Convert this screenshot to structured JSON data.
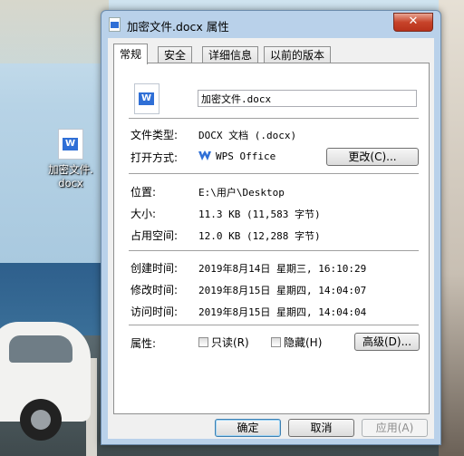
{
  "desktop": {
    "icon_label_line1": "加密文件.",
    "icon_label_line2": "docx",
    "icon_glyph": "W"
  },
  "window": {
    "title": "加密文件.docx 属性",
    "close_glyph": "✕"
  },
  "tabs": [
    {
      "label": "常规",
      "active": true
    },
    {
      "label": "安全"
    },
    {
      "label": "详细信息"
    },
    {
      "label": "以前的版本"
    }
  ],
  "general": {
    "file_glyph": "W",
    "file_name": "加密文件.docx",
    "type_label": "文件类型:",
    "type_value": "DOCX 文档 (.docx)",
    "opens_with_label": "打开方式:",
    "opens_with_value": "WPS Office",
    "change_button": "更改(C)...",
    "location_label": "位置:",
    "location_value": "E:\\用户\\Desktop",
    "size_label": "大小:",
    "size_value": "11.3 KB (11,583 字节)",
    "size_on_disk_label": "占用空间:",
    "size_on_disk_value": "12.0 KB (12,288 字节)",
    "created_label": "创建时间:",
    "created_value": "2019年8月14日 星期三, 16:10:29",
    "modified_label": "修改时间:",
    "modified_value": "2019年8月15日 星期四, 14:04:07",
    "accessed_label": "访问时间:",
    "accessed_value": "2019年8月15日 星期四, 14:04:04",
    "attributes_label": "属性:",
    "readonly_label": "只读(R)",
    "readonly_checked": false,
    "hidden_label": "隐藏(H)",
    "hidden_checked": false,
    "advanced_button": "高级(D)..."
  },
  "footer": {
    "ok": "确定",
    "cancel": "取消",
    "apply": "应用(A)"
  },
  "colors": {
    "accent_word_blue": "#2f6fd6",
    "close_red": "#c7432a",
    "window_frame": "#b9d1ea"
  }
}
